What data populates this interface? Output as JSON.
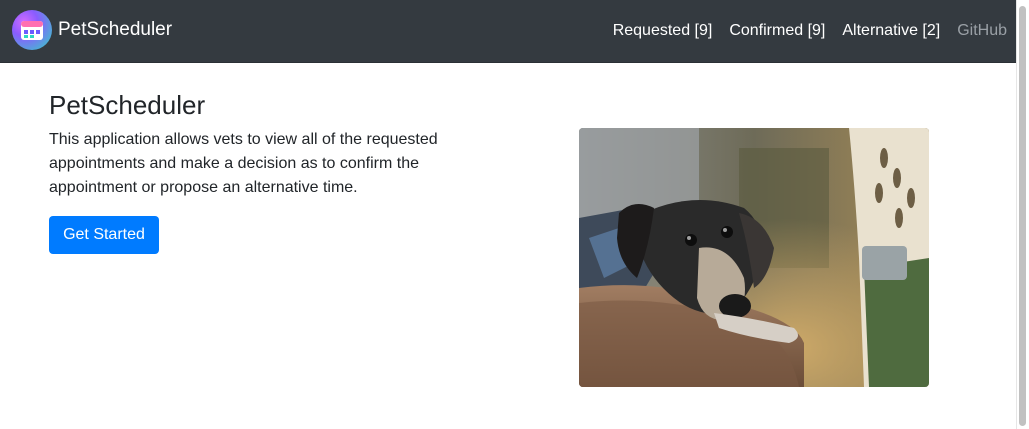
{
  "brand": {
    "name": "PetScheduler",
    "logo_icon": "calendar-icon"
  },
  "nav": {
    "links": [
      {
        "label": "Requested [9]"
      },
      {
        "label": "Confirmed [9]"
      },
      {
        "label": "Alternative [2]"
      },
      {
        "label": "GitHub"
      }
    ]
  },
  "hero": {
    "title": "PetScheduler",
    "description": "This application allows vets to view all of the requested appointments and make a decision as to confirm the appointment or propose an alternative time.",
    "button_label": "Get Started",
    "image_icon": "dog-photo-icon"
  },
  "colors": {
    "navbar": "#343a40",
    "primary_button": "#007bff",
    "link_muted": "#9aa0a6"
  }
}
